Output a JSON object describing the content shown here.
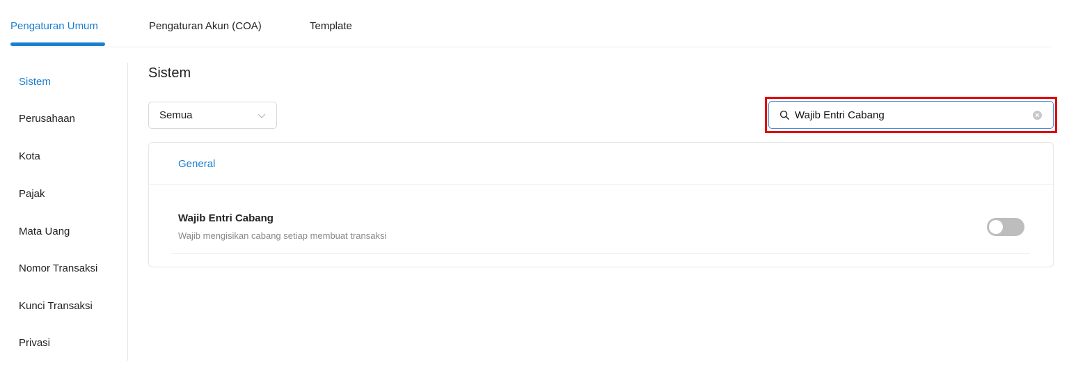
{
  "tabs": [
    {
      "label": "Pengaturan Umum",
      "active": true
    },
    {
      "label": "Pengaturan Akun (COA)",
      "active": false
    },
    {
      "label": "Template",
      "active": false
    }
  ],
  "sidebar": {
    "items": [
      {
        "label": "Sistem",
        "active": true
      },
      {
        "label": "Perusahaan"
      },
      {
        "label": "Kota"
      },
      {
        "label": "Pajak"
      },
      {
        "label": "Mata Uang"
      },
      {
        "label": "Nomor Transaksi"
      },
      {
        "label": "Kunci Transaksi"
      },
      {
        "label": "Privasi"
      }
    ]
  },
  "main": {
    "title": "Sistem",
    "filter": {
      "selected": "Semua"
    },
    "search": {
      "value": "Wajib Entri Cabang"
    },
    "section": {
      "label": "General",
      "setting": {
        "title": "Wajib Entri Cabang",
        "description": "Wajib mengisikan cabang setiap membuat transaksi",
        "enabled": false
      }
    }
  },
  "colors": {
    "accent": "#1a7fd0",
    "highlight": "#e00000",
    "toggle_off": "#bdbdbd"
  },
  "icons": {
    "search": "search-icon",
    "clear": "clear-icon",
    "chevron": "chevron-down-icon"
  }
}
